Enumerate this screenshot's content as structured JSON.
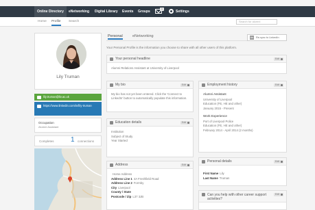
{
  "nav": {
    "items": [
      "Online Directory",
      "eNetworking",
      "Digital Library",
      "Events",
      "Groups"
    ],
    "mail_count": "1",
    "settings_label": "Settings"
  },
  "subnav": {
    "tabs": [
      "Home",
      "Profile",
      "Search"
    ],
    "search_placeholder": "Search for alumni"
  },
  "profile": {
    "name": "Lily Truman",
    "email": "lily.truman@liv.ac.uk",
    "linkedin_url": "https://www.linkedin.com/in/lily-truman",
    "occupation_label": "Occupation",
    "occupation_value": "Alumni Assistant",
    "completes_label": "Completes",
    "connections_count": "1",
    "connections_label": "connections"
  },
  "tabs": {
    "personal": "Personal",
    "enetworking": "eNetworking",
    "sync_linkedin": "Re-sync to LinkedIn"
  },
  "intro_text": "Your Personal Profile is the information you choose to share with all other users of this platform.",
  "edit_label": "Edit",
  "headline": {
    "title": "Your personal headline",
    "text": "Alumni Relations Assistant at University of Liverpool"
  },
  "bio": {
    "title": "My bio",
    "text": "My bio has not yet been entered. Click the 'Connect to LinkedIn' button to automatically populate this information."
  },
  "education": {
    "title": "Education details",
    "fields": [
      "Institution",
      "Subject of Study",
      "Year Started"
    ]
  },
  "address": {
    "title": "Address",
    "rows": [
      {
        "label": "",
        "value": "Home Address"
      },
      {
        "label": "Address Line 1",
        "value": "4A Freshfield Road"
      },
      {
        "label": "Address Line 2",
        "value": "Formby"
      },
      {
        "label": "City",
        "value": "Liverpool"
      },
      {
        "label": "County / State",
        "value": ""
      },
      {
        "label": "Postcode / Zip",
        "value": "L37 3JB"
      }
    ]
  },
  "employment": {
    "title": "Employment history",
    "jobs": [
      {
        "title": "Alumni Assistant",
        "org": "University of Liverpool",
        "edu": "Education (FE, HE and other)",
        "dates": "January 2015 - Present"
      },
      {
        "title": "Work Experience",
        "org": "Port of Liverpool Police",
        "edu": "Education (FE, HE and other)",
        "dates": "February 2014 - April 2014 (2 months)"
      }
    ]
  },
  "personal": {
    "title": "Personal details",
    "rows": [
      {
        "label": "First Name",
        "value": "Lily"
      },
      {
        "label": "Last Name",
        "value": "Truman"
      }
    ]
  },
  "help": {
    "title": "Can you help with other career support activities?"
  },
  "colors": {
    "nav_bg": "#2f3a45",
    "email_green": "#5ba53e",
    "linkedin_blue": "#2779b5",
    "accent": "#2a7bbf"
  },
  "icons": [
    "mail-icon",
    "gear-icon",
    "linkedin-icon",
    "email-icon",
    "person-icon",
    "book-icon",
    "pin-icon",
    "briefcase-icon",
    "id-card-icon",
    "question-icon",
    "quote-icon"
  ]
}
